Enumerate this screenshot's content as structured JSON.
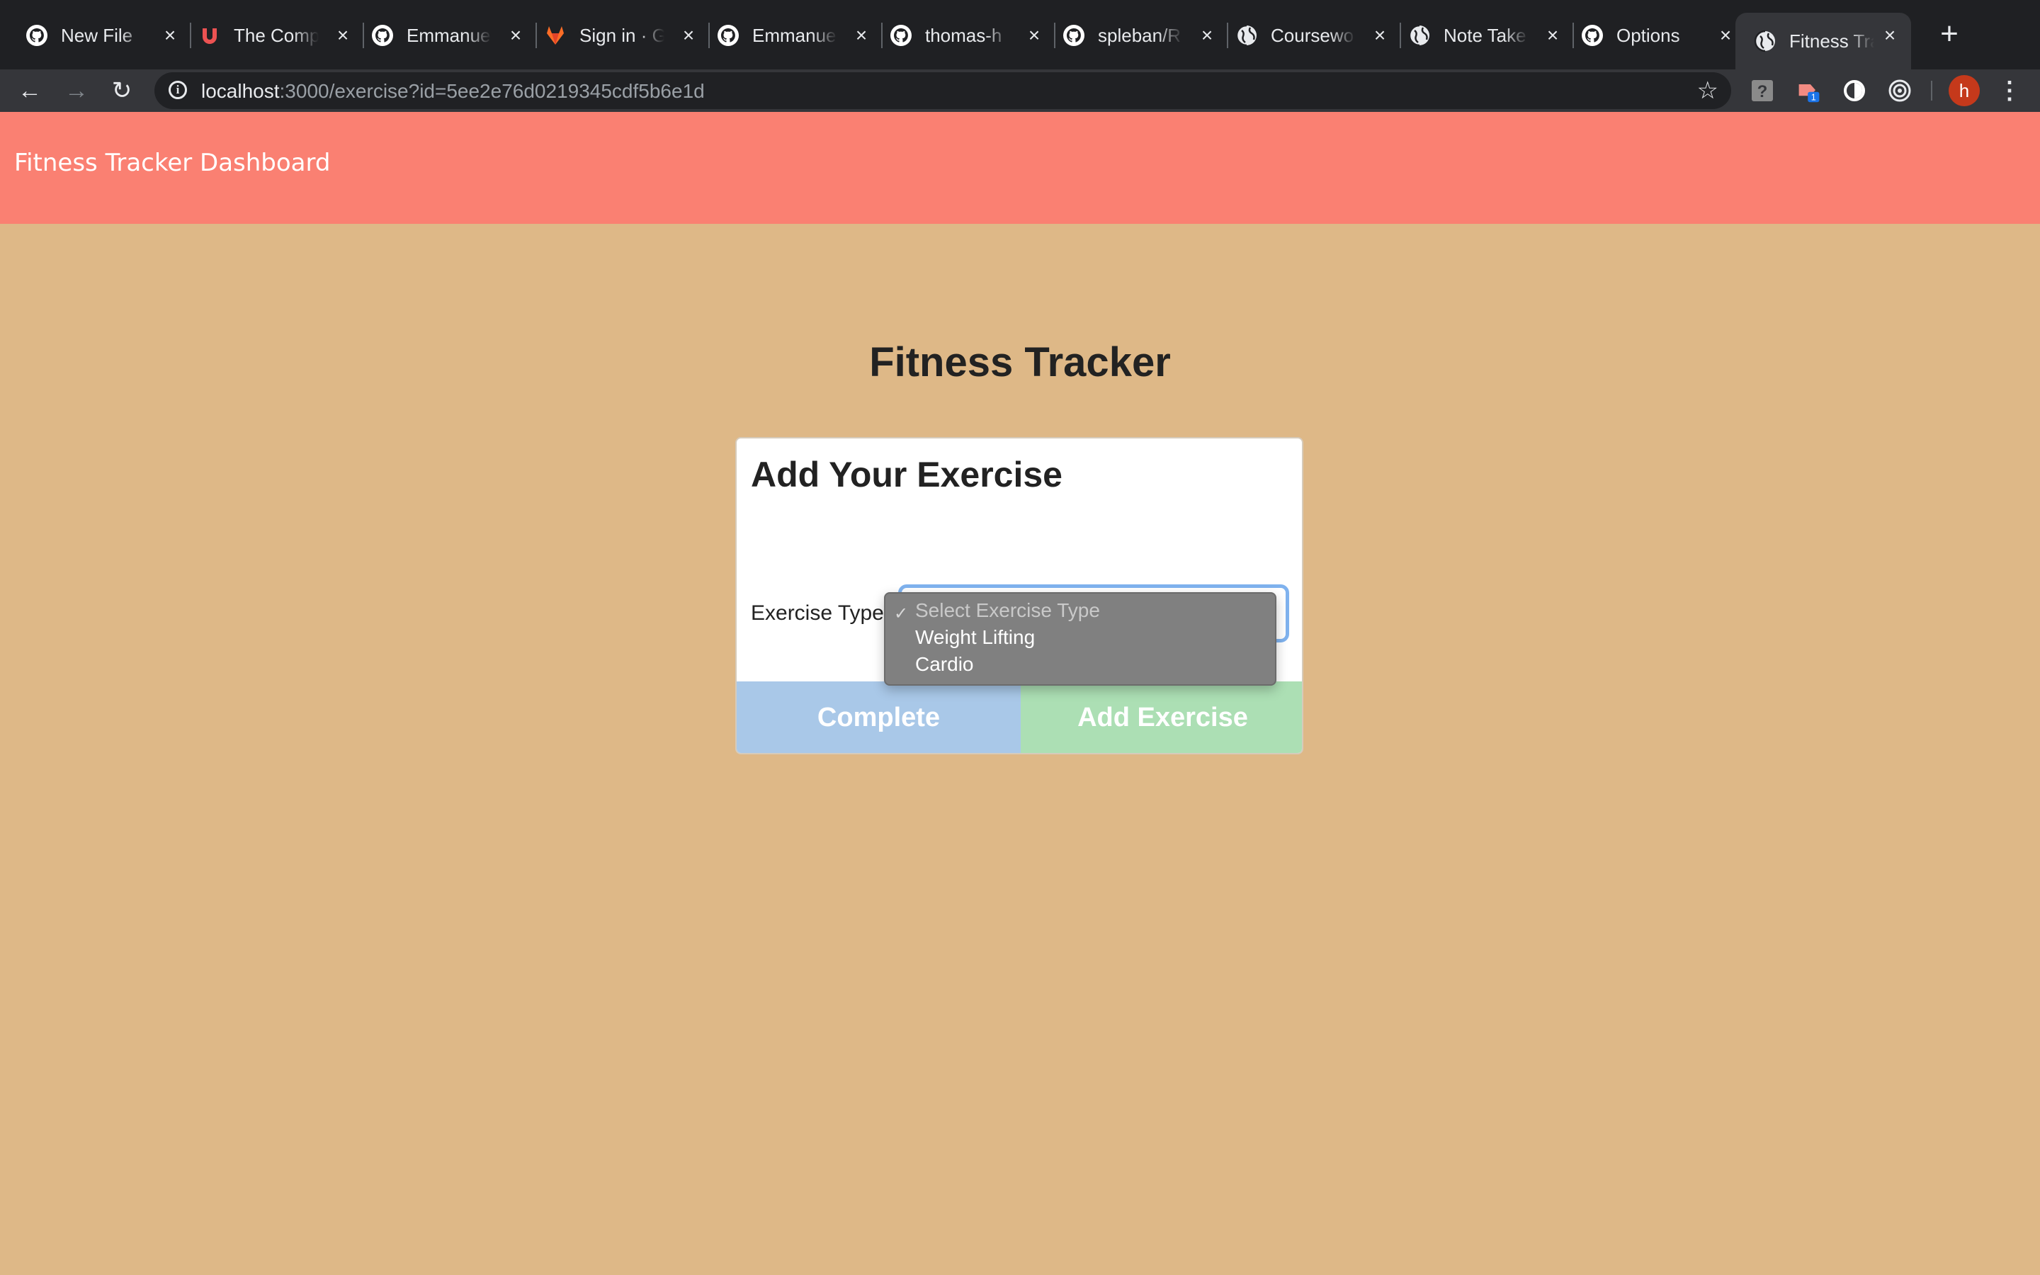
{
  "browser": {
    "tabs": [
      {
        "label": "New File",
        "icon": "github-icon"
      },
      {
        "label": "The Comp",
        "icon": "udemy-icon"
      },
      {
        "label": "Emmanuel",
        "icon": "github-icon"
      },
      {
        "label": "Sign in · G",
        "icon": "gitlab-icon"
      },
      {
        "label": "Emmanuel",
        "icon": "github-icon"
      },
      {
        "label": "thomas-h",
        "icon": "github-icon"
      },
      {
        "label": "spleban/R",
        "icon": "github-icon"
      },
      {
        "label": "Coursewo",
        "icon": "globe-icon"
      },
      {
        "label": "Note Take",
        "icon": "globe-icon"
      },
      {
        "label": "Options",
        "icon": "github-icon"
      },
      {
        "label": "Fitness Tra",
        "icon": "globe-icon"
      }
    ],
    "url_host": "localhost",
    "url_rest": ":3000/exercise?id=5ee2e76d0219345cdf5b6e1d",
    "extension_badge": "1",
    "profile_initial": "h"
  },
  "navbar": {
    "brand": "Fitness Tracker Dashboard"
  },
  "main": {
    "title": "Fitness Tracker",
    "card": {
      "title": "Add Your Exercise",
      "exercise_type_label": "Exercise Type:",
      "select": {
        "options": [
          "Select Exercise Type",
          "Weight Lifting",
          "Cardio"
        ],
        "selected_index": 0,
        "check": "✓"
      },
      "complete_label": "Complete",
      "add_label": "Add Exercise"
    }
  },
  "colors": {
    "page_bg": "#deb887",
    "navbar_bg": "#fa8072",
    "complete_bg": "#a9c8e8",
    "add_bg": "#acdfb4",
    "select_focus": "#7fb2ee"
  }
}
